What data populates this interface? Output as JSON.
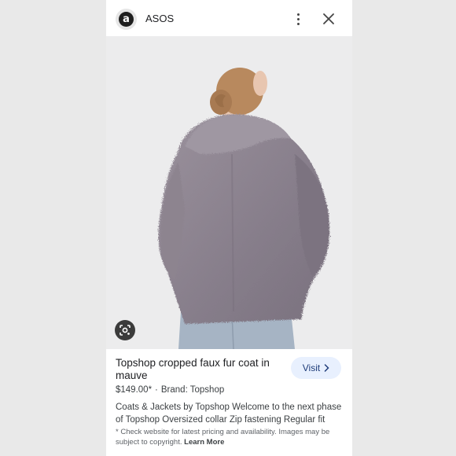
{
  "header": {
    "logo_letter": "a",
    "site_name": "ASOS"
  },
  "icons": {
    "more": "more-vert-icon",
    "close": "close-icon",
    "lens": "google-lens-icon",
    "visit_arrow": "chevron-right-icon"
  },
  "product": {
    "title": "Topshop cropped faux fur coat in mauve",
    "visit_label": "Visit",
    "price": "$149.00*",
    "separator": "·",
    "brand": "Brand: Topshop",
    "description": "Coats & Jackets by Topshop Welcome to the next phase of Topshop Oversized collar Zip fastening Regular fit",
    "disclaimer": "* Check website for latest pricing and availability. Images may be subject to copyright.",
    "learn_more": "Learn More"
  },
  "colors": {
    "coat": "#8a818d",
    "hair": "#b8895e",
    "skin": "#e8c6b0",
    "jeans": "#a6b4c4",
    "visit_bg": "#e8f0fe"
  }
}
